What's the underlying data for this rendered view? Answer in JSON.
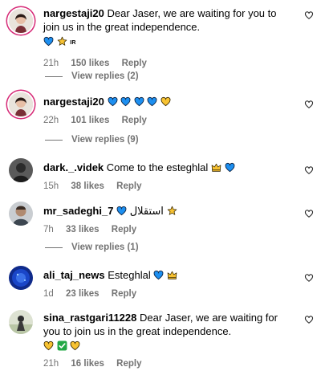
{
  "comments": [
    {
      "username": "nargestaji20",
      "text": "Dear Jaser, we are waiting for you to join us in the great independence.",
      "emoji_line": "IR",
      "time": "21h",
      "likes": "150 likes",
      "reply_label": "Reply",
      "view_replies": "View replies (2)"
    },
    {
      "username": "nargestaji20",
      "text": "",
      "time": "22h",
      "likes": "101 likes",
      "reply_label": "Reply",
      "view_replies": "View replies (9)"
    },
    {
      "username": "dark._.videk",
      "text": "Come to the esteghlal",
      "time": "15h",
      "likes": "38 likes",
      "reply_label": "Reply"
    },
    {
      "username": "mr_sadeghi_7",
      "text": "استقلال",
      "time": "7h",
      "likes": "33 likes",
      "reply_label": "Reply",
      "view_replies": "View replies (1)"
    },
    {
      "username": "ali_taj_news",
      "text": "Esteghlal",
      "time": "1d",
      "likes": "23 likes",
      "reply_label": "Reply"
    },
    {
      "username": "sina_rastgari11228",
      "text": "Dear Jaser, we are waiting for you to join us in the great independence.",
      "time": "21h",
      "likes": "16 likes",
      "reply_label": "Reply"
    }
  ],
  "colors": {
    "meta_gray": "#737373",
    "blue_heart": "#1d8ff0",
    "yellow_heart": "#f7c232",
    "story_ring": "#d62976"
  },
  "icons": {
    "like": "heart-outline-icon",
    "blue_heart": "blue-heart-icon",
    "yellow_heart": "yellow-heart-icon",
    "star": "star-icon",
    "crown": "crown-icon",
    "check": "check-mark-icon"
  }
}
